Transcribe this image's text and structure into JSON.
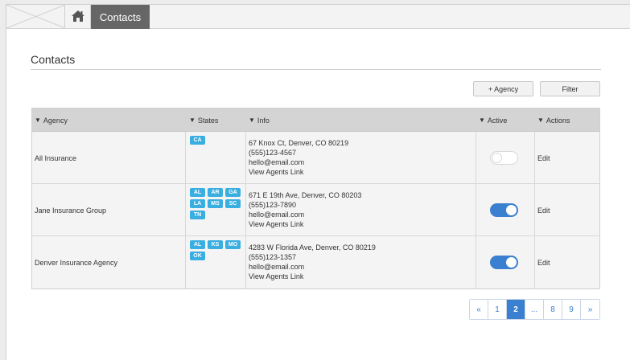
{
  "nav": {
    "active_tab": "Contacts"
  },
  "page": {
    "title": "Contacts"
  },
  "toolbar": {
    "add_agency_label": "+ Agency",
    "filter_label": "Filter"
  },
  "table": {
    "columns": [
      "Agency",
      "States",
      "Info",
      "Active",
      "Actions"
    ],
    "rows": [
      {
        "agency": "All Insurance",
        "states": [
          "CA"
        ],
        "address": "67 Knox Ct, Denver, CO 80219",
        "phone": "(555)123-4567",
        "email": "hello@email.com",
        "link": "View Agents Link",
        "active": false,
        "action": "Edit"
      },
      {
        "agency": "Jane Insurance Group",
        "states": [
          "AL",
          "AR",
          "GA",
          "LA",
          "MS",
          "SC",
          "TN"
        ],
        "address": "671 E 19th Ave, Denver, CO 80203",
        "phone": "(555)123-7890",
        "email": "hello@email.com",
        "link": "View Agents Link",
        "active": true,
        "action": "Edit"
      },
      {
        "agency": "Denver Insurance Agency",
        "states": [
          "AL",
          "KS",
          "MO",
          "OK"
        ],
        "address": "4283 W Florida Ave, Denver, CO 80219",
        "phone": "(555)123-1357",
        "email": "hello@email.com",
        "link": "View Agents Link",
        "active": true,
        "action": "Edit"
      }
    ]
  },
  "pagination": {
    "items": [
      "«",
      "1",
      "2",
      "...",
      "8",
      "9",
      "»"
    ],
    "current": "2"
  },
  "colors": {
    "accent": "#3a7fd0",
    "badge": "#39aee0",
    "tab": "#666666"
  },
  "icons": {
    "home": "home-icon",
    "logo": "placeholder-logo",
    "sort": "caret-down-icon"
  }
}
